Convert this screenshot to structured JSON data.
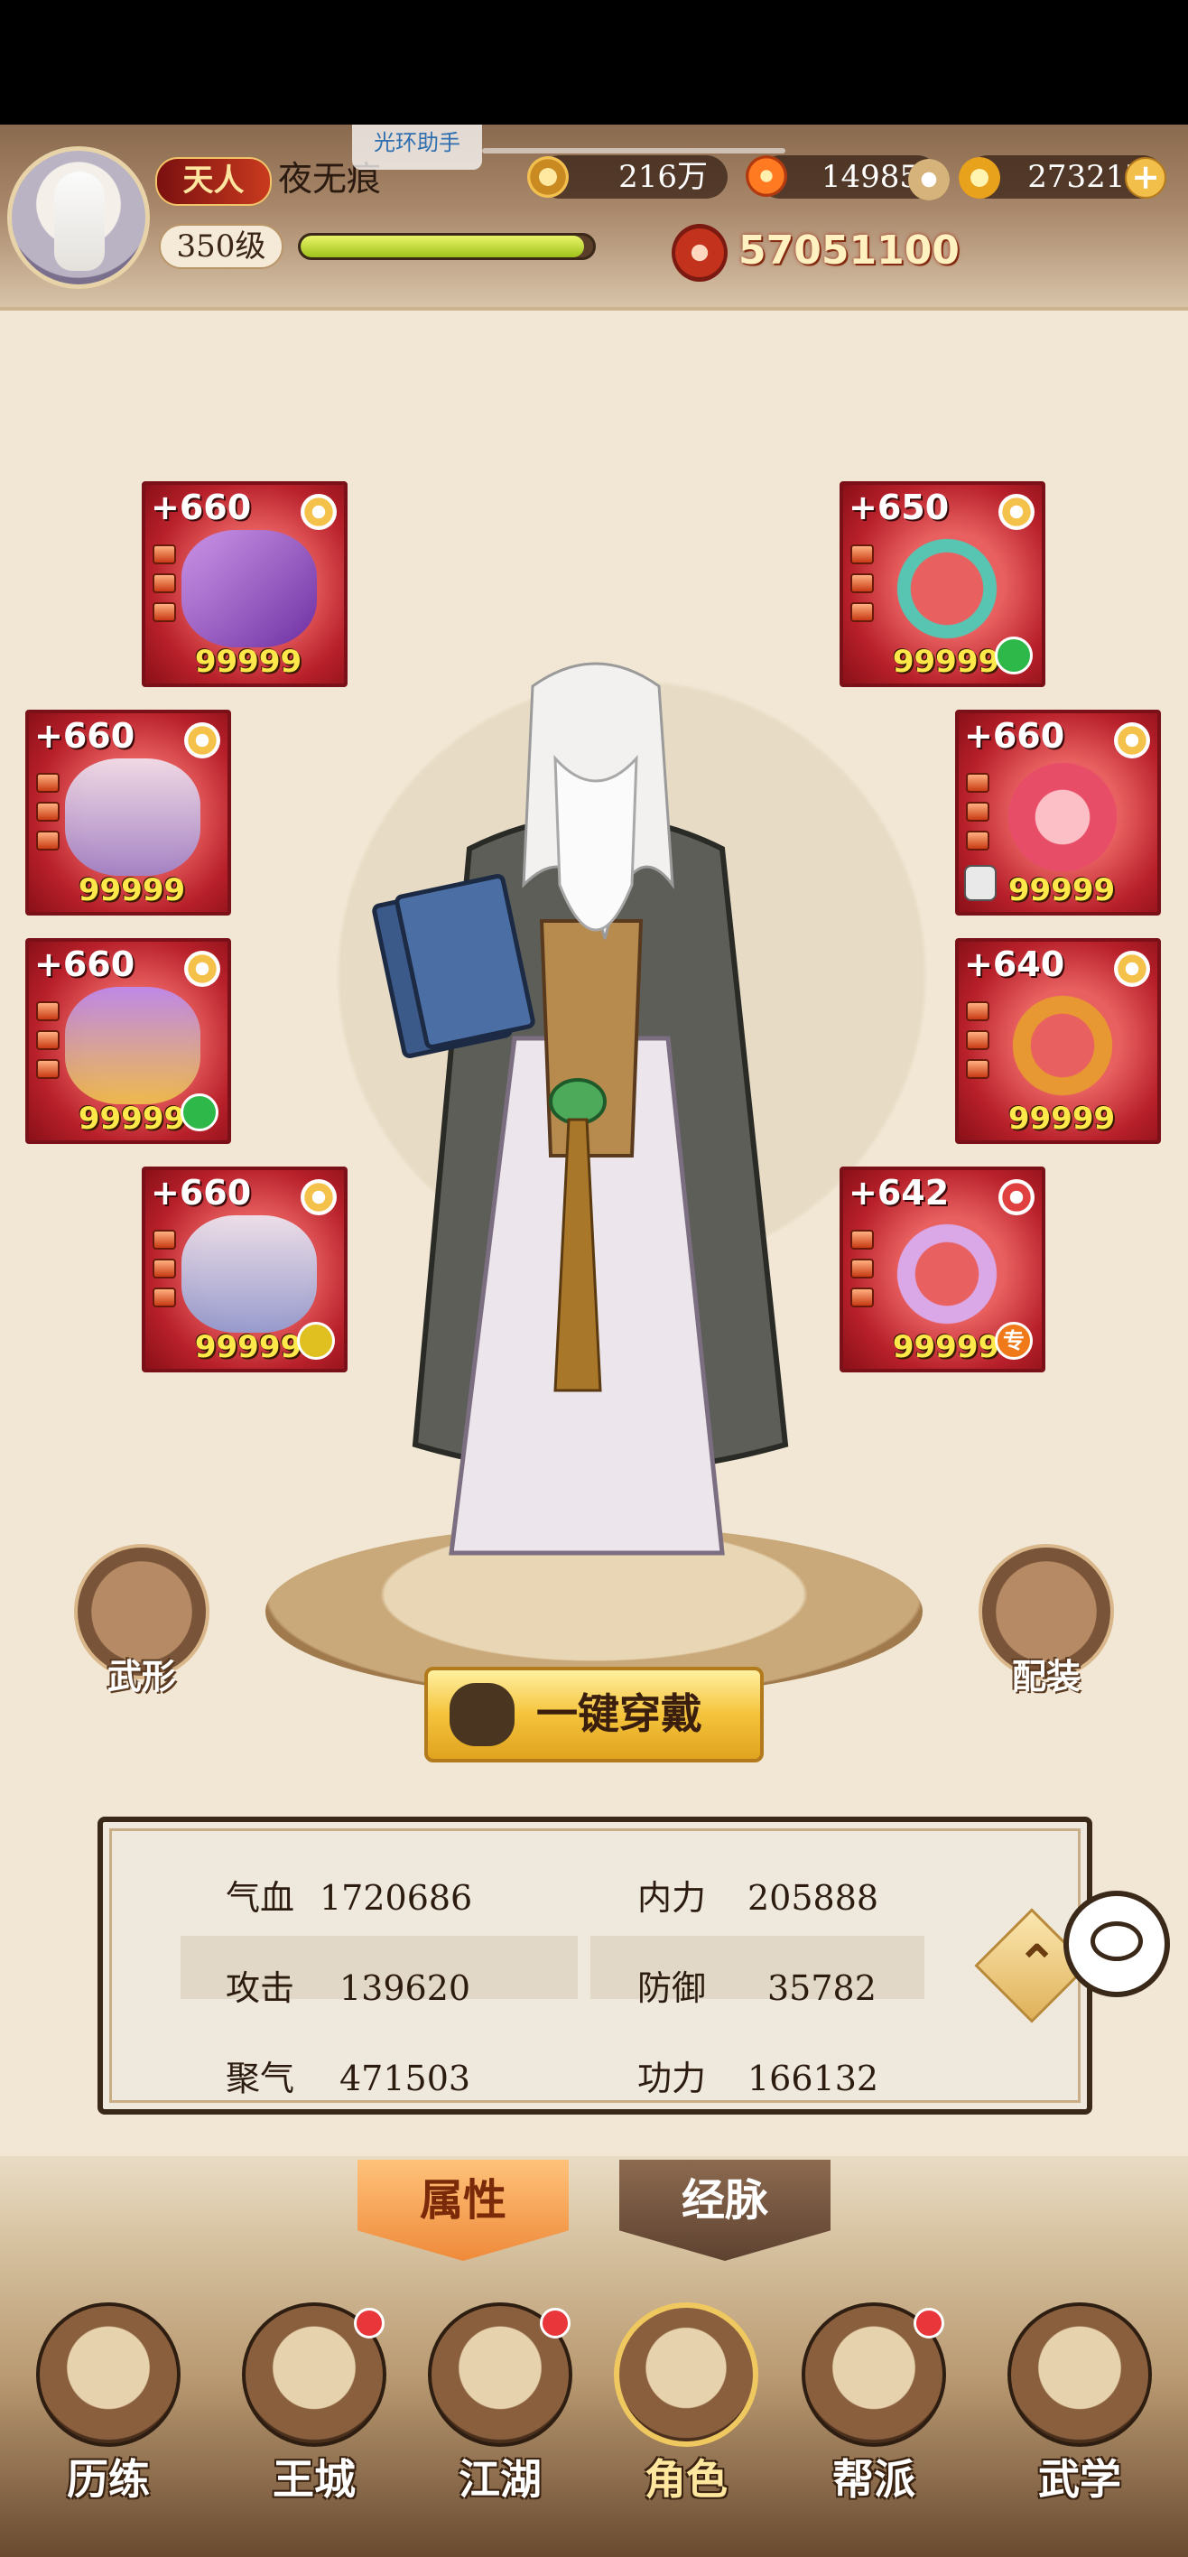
{
  "header": {
    "rank_badge": "天人",
    "player_name": "夜无痕",
    "helper_tag": "光环助手",
    "level": "350级",
    "exp_fraction": 0.97,
    "combat_power": "57051100"
  },
  "resources": {
    "coins": "216万",
    "embers": "14985",
    "gold": "273217"
  },
  "equipment": [
    {
      "slot": "weapon",
      "level": "+660",
      "count": "99999",
      "link": false
    },
    {
      "slot": "necklace",
      "level": "+650",
      "count": "99999",
      "link": true
    },
    {
      "slot": "robe",
      "level": "+660",
      "count": "99999",
      "link": false
    },
    {
      "slot": "amulet",
      "level": "+660",
      "count": "99999",
      "locked": true
    },
    {
      "slot": "belt",
      "level": "+660",
      "count": "99999",
      "link": true
    },
    {
      "slot": "bracelet",
      "level": "+640",
      "count": "99999",
      "link": false
    },
    {
      "slot": "boots",
      "level": "+660",
      "count": "99999",
      "link": true
    },
    {
      "slot": "ring",
      "level": "+642",
      "count": "99999",
      "badge": "专"
    }
  ],
  "buttons": {
    "appearance": "武形",
    "outfit": "配装",
    "equip_all": "一键穿戴"
  },
  "stats": {
    "hp_label": "气血",
    "hp_value": "1720686",
    "inner_label": "内力",
    "inner_value": "205888",
    "attack_label": "攻击",
    "attack_value": "139620",
    "defense_label": "防御",
    "defense_value": "35782",
    "qi_label": "聚气",
    "qi_value": "471503",
    "skill_label": "功力",
    "skill_value": "166132"
  },
  "tabs": {
    "attributes": "属性",
    "meridians": "经脉"
  },
  "nav": [
    {
      "label": "历练",
      "dot": false
    },
    {
      "label": "王城",
      "dot": true
    },
    {
      "label": "江湖",
      "dot": true
    },
    {
      "label": "角色",
      "dot": false,
      "active": true
    },
    {
      "label": "帮派",
      "dot": true
    },
    {
      "label": "武学",
      "dot": false
    }
  ],
  "colors": {
    "slot_red": "#b8202a",
    "accent_gold": "#f5c33b",
    "tab_active": "#ef8a3a"
  }
}
